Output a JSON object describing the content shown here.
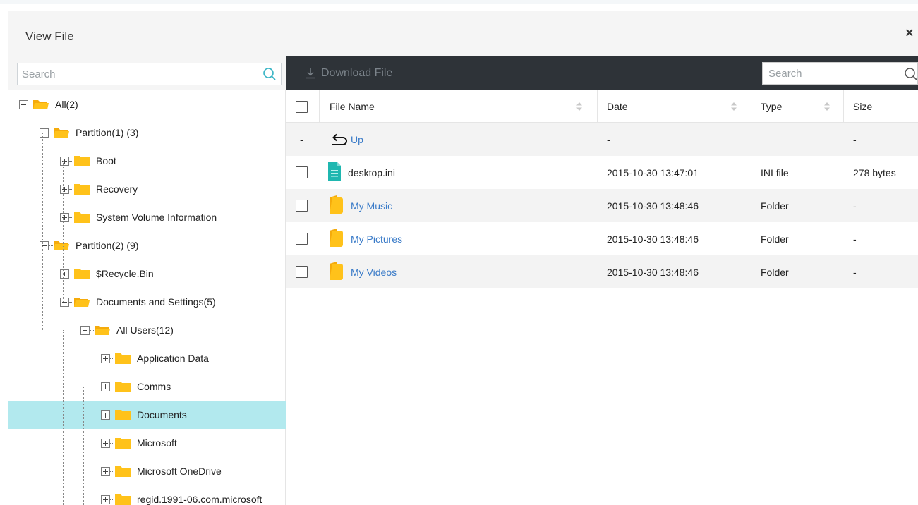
{
  "dialog": {
    "title": "View File",
    "close": "×"
  },
  "left": {
    "search_placeholder": "Search",
    "tree": [
      {
        "label": "All(2)",
        "depth": 0,
        "expanded": true
      },
      {
        "label": "Partition(1) (3)",
        "depth": 1,
        "expanded": true
      },
      {
        "label": "Boot",
        "depth": 2,
        "expanded": false
      },
      {
        "label": "Recovery",
        "depth": 2,
        "expanded": false
      },
      {
        "label": "System Volume Information",
        "depth": 2,
        "expanded": false
      },
      {
        "label": "Partition(2) (9)",
        "depth": 1,
        "expanded": true
      },
      {
        "label": "$Recycle.Bin",
        "depth": 2,
        "expanded": false
      },
      {
        "label": "Documents and Settings(5)",
        "depth": 2,
        "expanded": true
      },
      {
        "label": "All Users(12)",
        "depth": 3,
        "expanded": true
      },
      {
        "label": "Application Data",
        "depth": 4,
        "expanded": false
      },
      {
        "label": "Comms",
        "depth": 4,
        "expanded": false
      },
      {
        "label": "Documents",
        "depth": 4,
        "expanded": false,
        "selected": true
      },
      {
        "label": "Microsoft",
        "depth": 4,
        "expanded": false
      },
      {
        "label": "Microsoft OneDrive",
        "depth": 4,
        "expanded": false
      },
      {
        "label": "regid.1991-06.com.microsoft",
        "depth": 4,
        "expanded": false
      }
    ]
  },
  "right": {
    "download_label": "Download File",
    "search_placeholder": "Search",
    "columns": {
      "name": "File Name",
      "date": "Date",
      "type": "Type",
      "size": "Size"
    },
    "up_row": {
      "marker": "-",
      "name": "Up",
      "date": "-",
      "size": "-"
    },
    "files": [
      {
        "name": "desktop.ini",
        "date": "2015-10-30 13:47:01",
        "type": "INI file",
        "size": "278 bytes",
        "icon": "file-icon"
      },
      {
        "name": "My Music",
        "date": "2015-10-30 13:48:46",
        "type": "Folder",
        "size": "-",
        "icon": "folder-icon"
      },
      {
        "name": "My Pictures",
        "date": "2015-10-30 13:48:46",
        "type": "Folder",
        "size": "-",
        "icon": "folder-icon"
      },
      {
        "name": "My Videos",
        "date": "2015-10-30 13:48:46",
        "type": "Folder",
        "size": "-",
        "icon": "folder-icon"
      }
    ]
  },
  "colors": {
    "accent": "#3a7bc8",
    "selected": "#b2e9ee",
    "toolbar": "#2e3338",
    "folder": "#ffc21a",
    "file": "#1fb7b0"
  }
}
